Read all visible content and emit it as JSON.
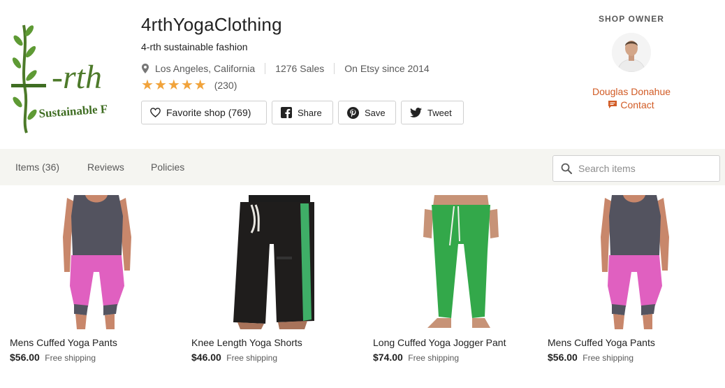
{
  "shop": {
    "logo": {
      "text": "-rth",
      "subtext": "Sustainable F"
    },
    "name": "4rthYogaClothing",
    "tagline": "4-rth sustainable fashion",
    "location": "Los Angeles, California",
    "sales": "1276 Sales",
    "since": "On Etsy since 2014",
    "rating": 5,
    "review_count": "(230)",
    "colors": {
      "star": "#f1a33b",
      "accent": "#d15b25"
    }
  },
  "actions": {
    "favorite": "Favorite shop (769)",
    "share": "Share",
    "save": "Save",
    "tweet": "Tweet"
  },
  "owner": {
    "label": "SHOP OWNER",
    "name": "Douglas Donahue",
    "contact": "Contact"
  },
  "nav": {
    "items": [
      "Items (36)",
      "Reviews",
      "Policies"
    ],
    "search_placeholder": "Search items"
  },
  "listings": [
    {
      "title": "Mens Cuffed Yoga Pants",
      "price": "$56.00",
      "shipping": "Free shipping",
      "image": "pink-cuffed-pants"
    },
    {
      "title": "Knee Length Yoga Shorts",
      "price": "$46.00",
      "shipping": "Free shipping",
      "image": "black-green-shorts"
    },
    {
      "title": "Long Cuffed Yoga Jogger Pant",
      "price": "$74.00",
      "shipping": "Free shipping",
      "image": "green-jogger-pants"
    },
    {
      "title": "Mens Cuffed Yoga Pants",
      "price": "$56.00",
      "shipping": "Free shipping",
      "image": "pink-cuffed-pants"
    }
  ]
}
